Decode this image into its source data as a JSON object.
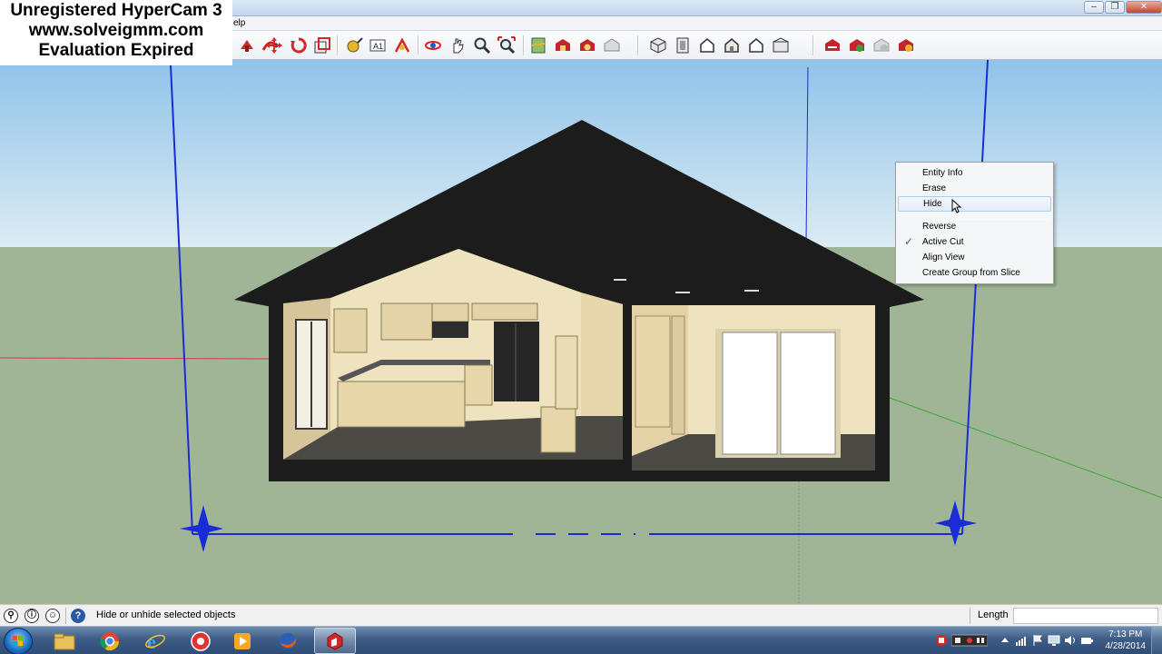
{
  "window": {
    "menu_fragment": "elp",
    "controls": [
      "minimize",
      "restore",
      "close"
    ]
  },
  "watermark": {
    "line1": "Unregistered HyperCam 3",
    "line2": "www.solveigmm.com",
    "line3": "Evaluation Expired"
  },
  "toolbar": {
    "groups": [
      [
        "push-pull-icon",
        "follow-me-icon",
        "move-icon",
        "rotate-icon",
        "scale-icon"
      ],
      [
        "tape-measure-icon",
        "dimension-icon",
        "text-icon"
      ],
      [
        "orbit-icon",
        "pan-icon",
        "zoom-icon",
        "zoom-extents-icon"
      ],
      [
        "map-icon",
        "warehouse-get-icon",
        "warehouse-share-icon",
        "extension-icon"
      ],
      [
        "iso-view-icon",
        "top-view-icon",
        "front-view-icon",
        "right-view-icon",
        "back-view-icon",
        "left-view-icon"
      ],
      [
        "section-plane-icon",
        "section-display-icon",
        "section-cut-icon",
        "section-fill-icon"
      ]
    ]
  },
  "context_menu": {
    "items": [
      {
        "label": "Entity Info",
        "checked": false,
        "hover": false
      },
      {
        "label": "Erase",
        "checked": false,
        "hover": false
      },
      {
        "label": "Hide",
        "checked": false,
        "hover": true
      },
      {
        "label": "Reverse",
        "checked": false,
        "hover": false
      },
      {
        "label": "Active Cut",
        "checked": true,
        "hover": false
      },
      {
        "label": "Align View",
        "checked": false,
        "hover": false
      },
      {
        "label": "Create Group from Slice",
        "checked": false,
        "hover": false
      }
    ],
    "check_glyph": "✓"
  },
  "status": {
    "message": "Hide or unhide selected objects",
    "length_label": "Length",
    "length_value": "",
    "icons": [
      "geo-location-icon",
      "credits-icon",
      "user-icon",
      "help-icon"
    ]
  },
  "taskbar": {
    "apps": [
      "explorer-icon",
      "chrome-icon",
      "internet-explorer-icon",
      "recorder-icon",
      "media-player-icon",
      "firefox-icon",
      "sketchup-icon"
    ],
    "active_app": "sketchup-icon",
    "time": "7:13 PM",
    "date": "4/28/2014"
  },
  "colors": {
    "sky_top": "#8fc3ea",
    "sky_bottom": "#dbeaf3",
    "ground": "#9fb595",
    "roof": "#1c1c1c",
    "wall": "#efe2bf",
    "section_plane": "#1a2cd6",
    "axis_red": "#d33a3a",
    "axis_green": "#3ea83e"
  }
}
